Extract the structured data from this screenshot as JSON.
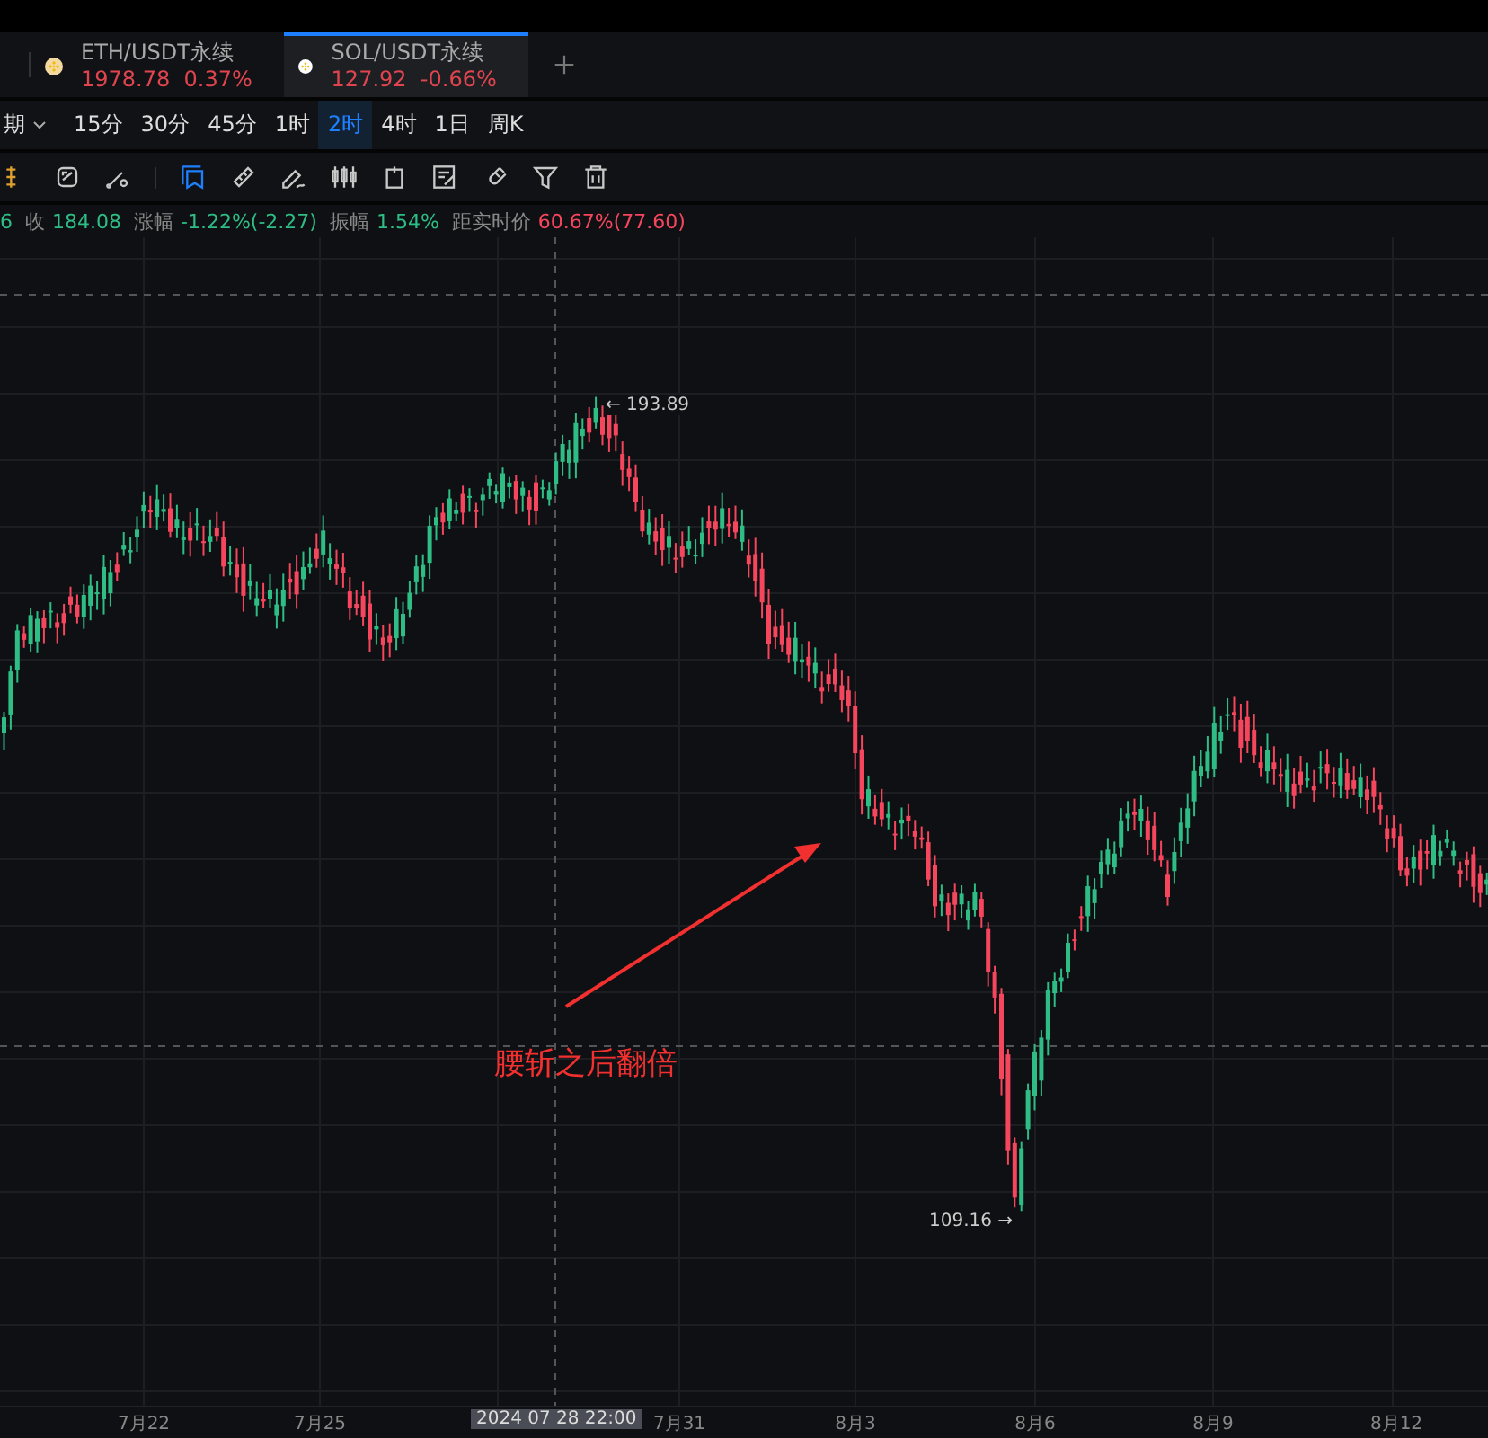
{
  "tabs": [
    {
      "symbol": "ETH/USDT永续",
      "price": "1978.78",
      "change": "0.37%",
      "selected": false
    },
    {
      "symbol": "SOL/USDT永续",
      "price": "127.92",
      "change": "-0.66%",
      "selected": true
    }
  ],
  "intervals": {
    "label": "期",
    "items": [
      {
        "label": "15分",
        "selected": false
      },
      {
        "label": "30分",
        "selected": false
      },
      {
        "label": "45分",
        "selected": false
      },
      {
        "label": "1时",
        "selected": false
      },
      {
        "label": "2时",
        "selected": true
      },
      {
        "label": "4时",
        "selected": false
      },
      {
        "label": "1日",
        "selected": false
      },
      {
        "label": "周K",
        "selected": false
      }
    ]
  },
  "tools": [
    {
      "kind": "partial",
      "selected": false
    },
    {
      "kind": "swap",
      "selected": false
    },
    {
      "kind": "line",
      "selected": false
    },
    {
      "kind": "corner",
      "selected": true
    },
    {
      "kind": "ruler",
      "selected": false
    },
    {
      "kind": "pencil",
      "selected": false
    },
    {
      "kind": "candles",
      "selected": false
    },
    {
      "kind": "box",
      "selected": false
    },
    {
      "kind": "note",
      "selected": false
    },
    {
      "kind": "magnet",
      "selected": false
    },
    {
      "kind": "filter",
      "selected": false
    },
    {
      "kind": "trash",
      "selected": false
    }
  ],
  "info": [
    {
      "value": "6",
      "color": "#2ebd85"
    },
    {
      "label": "收",
      "value": "184.08",
      "color": "#2ebd85"
    },
    {
      "label": "涨幅",
      "value": "-1.22%(-2.27)",
      "color": "#2ebd85"
    },
    {
      "label": "振幅",
      "value": "1.54%",
      "color": "#2ebd85"
    },
    {
      "label": "距实时价",
      "value": "60.67%(77.60)",
      "color": "#f6465d"
    }
  ],
  "chart": {
    "high_label": "← 193.89",
    "low_label": "109.16 →",
    "annotation": "腰斩之后翻倍",
    "crosshair_time": "2024 07 28 22:00",
    "x_labels": [
      "7月22",
      "7月25",
      "7月31",
      "8月3",
      "8月6",
      "8月9",
      "8月12"
    ]
  }
}
